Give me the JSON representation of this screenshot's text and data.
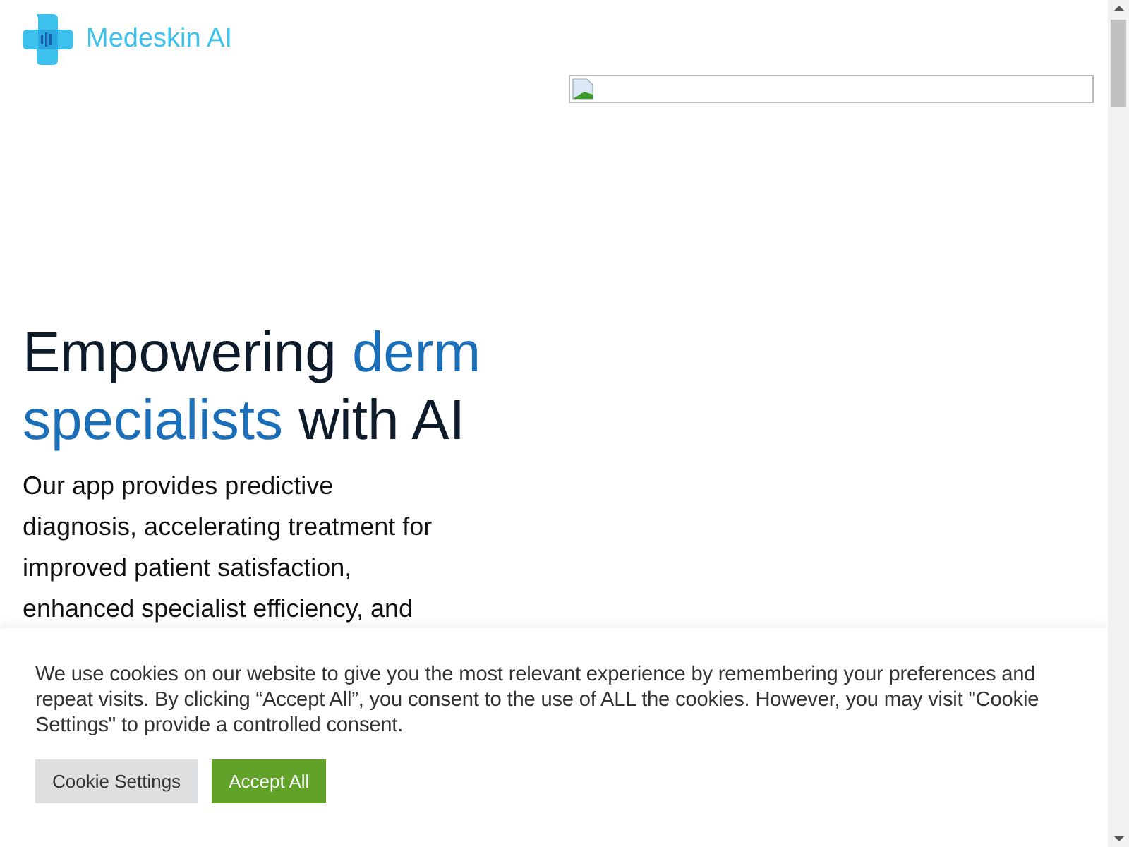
{
  "brand": {
    "name": "Medeskin AI"
  },
  "hero": {
    "headline": [
      {
        "text": "Empowering ",
        "highlight": false
      },
      {
        "text": "derm specialists",
        "highlight": true
      },
      {
        "text": " with AI",
        "highlight": false
      }
    ],
    "paragraph": "Our app provides predictive diagnosis, accelerating treatment for improved patient satisfaction, enhanced specialist efficiency, and"
  },
  "hero_image": {
    "kind": "broken-image"
  },
  "cookie_banner": {
    "message": "We use cookies on our website to give you the most relevant experience by remembering your preferences and repeat visits. By clicking “Accept All”, you consent to the use of ALL the cookies. However, you may visit \"Cookie Settings\" to provide a controlled consent.",
    "buttons": [
      {
        "label": "Cookie Settings",
        "kind": "secondary"
      },
      {
        "label": "Accept All",
        "kind": "primary"
      }
    ]
  }
}
